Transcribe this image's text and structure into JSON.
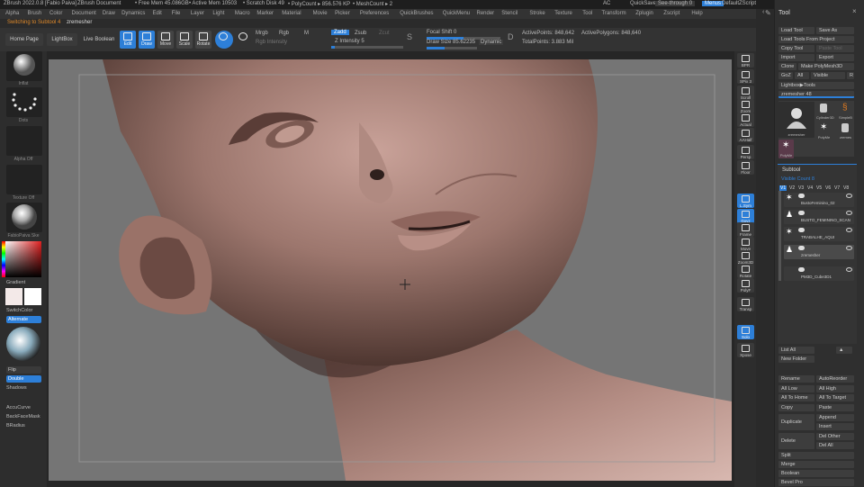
{
  "titlebar": {
    "app": "ZBrush 2022.0.8 [Fabio Paiva]",
    "doc": "ZBrush Document",
    "free_mem": "• Free Mem 45.086GB",
    "active_mem": "• Active Mem 10503",
    "scratch": "• Scratch Disk 49",
    "polycount": "• PolyCount ▸ 856.576 KP",
    "meshcount": "• MeshCount ▸ 2",
    "ac": "AC",
    "quicksave": "QuickSave",
    "seethrough": "See-through  0",
    "menus": "Menus",
    "zscript": "DefaultZScript"
  },
  "menubar": [
    "Alpha",
    "Brush",
    "Color",
    "Document",
    "Draw",
    "Dynamics",
    "Edit",
    "File",
    "Layer",
    "Light",
    "Macro",
    "Marker",
    "Material",
    "Movie",
    "Picker",
    "Preferences",
    "QuickBrushes",
    "QuickMenu",
    "Render",
    "Stencil",
    "Stroke",
    "Texture",
    "Tool",
    "Transform",
    "Zplugin",
    "Zscript",
    "Help"
  ],
  "status": {
    "message": "Switching to Subtool 4",
    "subtool": "zremesher"
  },
  "toolbar": {
    "home": "Home Page",
    "lightbox": "LightBox",
    "liveboolean": "Live Boolean",
    "edit": "Edit",
    "draw": "Draw",
    "move": "Move",
    "scale": "Scale",
    "rotate": "Rotate",
    "mrgb": "Mrgb",
    "rgb": "Rgb",
    "m": "M",
    "rgb_intensity": "Rgb Intensity",
    "zadd": "Zadd",
    "zsub": "Zsub",
    "zcut": "Zcut",
    "z_intensity": "Z Intensity 5",
    "z_intensity_value": 0.05,
    "focal_shift": "Focal Shift 0",
    "focal_shift_value": 0.5,
    "draw_size": "Draw Size 85.62235",
    "draw_size_value": 0.35,
    "dynamic": "Dynamic",
    "active_points": "ActivePoints: 848,642",
    "total_points": "TotalPoints: 3.883 Mil",
    "active_polys": "ActivePolygons: 848,640"
  },
  "lefttray": {
    "brush_label": "Inflat",
    "stroke_label": "Dots",
    "alpha_label": "Alpha Off",
    "texture_label": "Texture Off",
    "material_label": "FabioPaiva Ske",
    "gradient": "Gradient",
    "switchcolor": "SwitchColor",
    "alternate": "Alternate",
    "flip": "Flip",
    "double": "Double",
    "shadows": "Shadows",
    "accucurve": "AccuCurve",
    "backfacemask": "BackFaceMask",
    "bradius": "BRadius"
  },
  "righttray": [
    {
      "label": "BPR",
      "active": false
    },
    {
      "label": "SPix 3",
      "active": false
    },
    {
      "label": "Scroll",
      "active": false
    },
    {
      "label": "Zoom",
      "active": false
    },
    {
      "label": "Actual",
      "active": false
    },
    {
      "label": "AAHalf",
      "active": false
    },
    {
      "label": "Persp",
      "active": false
    },
    {
      "label": "Floor",
      "active": false
    },
    {
      "label": "L.Sym",
      "active": true
    },
    {
      "label": "Gxyz",
      "active": true
    },
    {
      "label": "Frame",
      "active": false
    },
    {
      "label": "Move",
      "active": false
    },
    {
      "label": "Zoom3D",
      "active": false
    },
    {
      "label": "Rotate",
      "active": false
    },
    {
      "label": "PolyF",
      "active": false
    },
    {
      "label": "Transp",
      "active": false
    },
    {
      "label": "Solo",
      "active": true
    },
    {
      "label": "Xpose",
      "active": false
    }
  ],
  "toolpanel": {
    "title": "Tool",
    "load_tool": "Load Tool",
    "save_as": "Save As",
    "load_from_project": "Load Tools From Project",
    "copy_tool": "Copy Tool",
    "paste_tool": "Paste Tool",
    "import": "Import",
    "export": "Export",
    "clone": "Clone",
    "make_polymesh": "Make PolyMesh3D",
    "goz": "GoZ",
    "all": "All",
    "visible": "Visible",
    "r": "R",
    "lightbox_tools": "Lightbox▶Tools",
    "zremesher_slider": "zremesher 48",
    "thumbs": [
      "zremesher",
      "Cylinder3D",
      "SimpleB",
      "PolyMe",
      "zremes",
      "PolyMe"
    ],
    "subtool_title": "Subtool",
    "visible_count": "Visible Count 8",
    "versions": [
      "V1",
      "V2",
      "V3",
      "V4",
      "V5",
      "V6",
      "V7",
      "V8"
    ],
    "subtools": [
      "BustoFeminino_02",
      "BUSTO_FEMININO_SCAN",
      "TRABALHE_AQUI",
      "zremesher",
      "PM3D_Cube3D1"
    ],
    "list_all": "List All",
    "new_folder": "New Folder",
    "rename": "Rename",
    "autoreorder": "AutoReorder",
    "all_low": "All Low",
    "all_high": "All High",
    "all_to_home": "All To Home",
    "all_to_target": "All To Target",
    "copy": "Copy",
    "paste": "Paste",
    "duplicate": "Duplicate",
    "append": "Append",
    "insert": "Insert",
    "delete": "Delete",
    "del_other": "Del Other",
    "del_all": "Del All",
    "split": "Split",
    "merge": "Merge",
    "boolean": "Boolean",
    "bevel_pro": "Bevel Pro"
  },
  "colors": {
    "accent": "#2d7fd8",
    "bg": "#2a2a2a",
    "viewport": "#757575",
    "skin": "#a37f76",
    "status_orange": "#e08a2a"
  }
}
